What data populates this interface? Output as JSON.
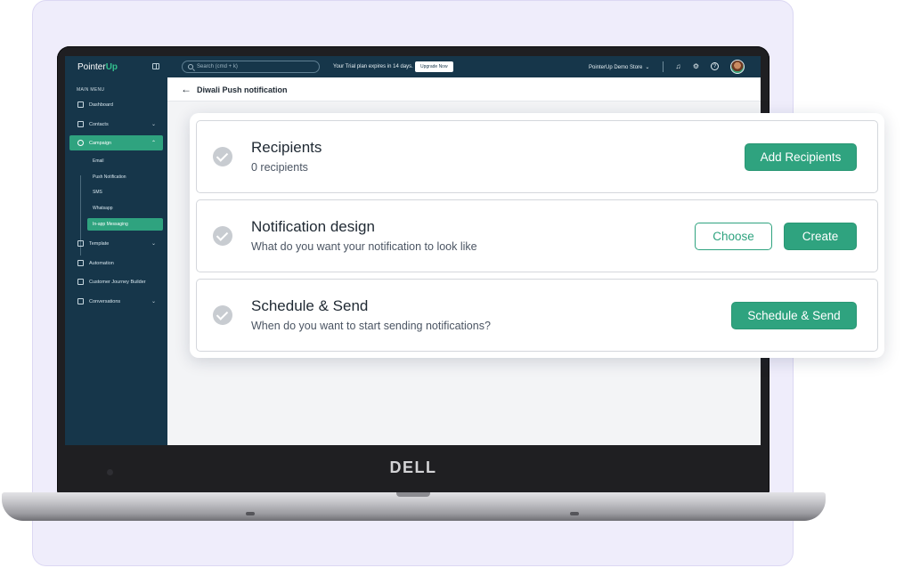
{
  "topbar": {
    "logo_prefix": "Pointer",
    "logo_suffix": "Up",
    "search_placeholder": "Search (cmd + k)",
    "trial_text": "Your Trial plan expires in 14 days.",
    "upgrade_label": "Upgrade Now",
    "store_name": "PointerUp Demo Store"
  },
  "sidebar": {
    "heading": "MAIN MENU",
    "items": [
      {
        "label": "Dashboard"
      },
      {
        "label": "Contacts"
      },
      {
        "label": "Campaign"
      },
      {
        "label": "Template"
      },
      {
        "label": "Automation"
      },
      {
        "label": "Customer Journey Builder"
      },
      {
        "label": "Conversations"
      }
    ],
    "campaign_sub": [
      {
        "label": "Email"
      },
      {
        "label": "Push Notification"
      },
      {
        "label": "SMS"
      },
      {
        "label": "Whatsapp"
      },
      {
        "label": "In-app Messaging"
      }
    ]
  },
  "header": {
    "title": "Diwali Push notification"
  },
  "steps": [
    {
      "title": "Recipients",
      "subtitle": "0 recipients",
      "buttons": [
        "Add Recipients"
      ]
    },
    {
      "title": "Notification design",
      "subtitle": "What do you want your notification to look like",
      "buttons": [
        "Choose",
        "Create"
      ]
    },
    {
      "title": "Schedule & Send",
      "subtitle": "When do you want to start sending notifications?",
      "buttons": [
        "Schedule & Send"
      ]
    }
  ],
  "laptop": {
    "brand": "DELL"
  },
  "colors": {
    "accent": "#2fa37f",
    "sidebar_bg": "#16364a",
    "background_panel": "#efedfb"
  }
}
